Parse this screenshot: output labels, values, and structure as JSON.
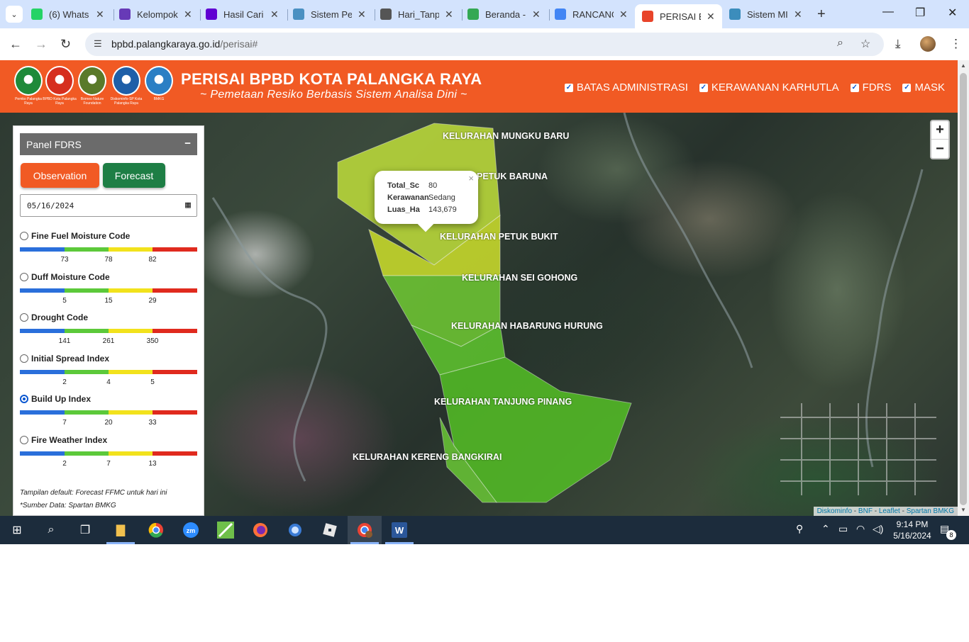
{
  "browser": {
    "tabs": [
      {
        "title": "(6) Whats",
        "icon": "whatsapp-icon",
        "color": "#25d366"
      },
      {
        "title": "Kelompok",
        "icon": "forms-icon",
        "color": "#673ab7"
      },
      {
        "title": "Hasil Cari",
        "icon": "yahoo-icon",
        "color": "#6001d2"
      },
      {
        "title": "Sistem Pe",
        "icon": "site-icon",
        "color": "#4a90c2"
      },
      {
        "title": "Hari_Tanp",
        "icon": "globe-icon",
        "color": "#555555"
      },
      {
        "title": "Beranda -",
        "icon": "drive-icon",
        "color": "#34a853"
      },
      {
        "title": "RANCANG",
        "icon": "docs-icon",
        "color": "#4285f4"
      },
      {
        "title": "PERISAI B",
        "icon": "bpbd-icon",
        "color": "#e8442a"
      },
      {
        "title": "Sistem MI",
        "icon": "map-icon",
        "color": "#3c8dbc"
      }
    ],
    "active_tab_index": 7,
    "url_host": "bpbd.palangkaraya.go.id",
    "url_path": "/perisai#"
  },
  "header": {
    "logos": [
      {
        "caption": "Pemko Palangka Raya",
        "color": "#1f8a3a"
      },
      {
        "caption": "BPBD Kota Palangka Raya",
        "color": "#d62f1f"
      },
      {
        "caption": "Borneo Nature Foundation",
        "color": "#5a7a2a"
      },
      {
        "caption": "Diskominfo-SP Kota Palangka Raya",
        "color": "#1e5fa8"
      },
      {
        "caption": "BMKG",
        "color": "#2b7fc4"
      }
    ],
    "title": "PERISAI BPBD KOTA PALANGKA RAYA",
    "subtitle": "~ Pemetaan Resiko Berbasis Sistem Analisa Dini ~",
    "layers": [
      "BATAS ADMINISTRASI",
      "KERAWANAN KARHUTLA",
      "FDRS",
      "MASK"
    ]
  },
  "panel": {
    "title": "Panel FDRS",
    "minimize": "−",
    "btn_observation": "Observation",
    "btn_forecast": "Forecast",
    "date": "05/16/2024",
    "indices": [
      {
        "name": "Fine Fuel Moisture Code",
        "ticks": [
          "73",
          "78",
          "82"
        ],
        "selected": false
      },
      {
        "name": "Duff Moisture Code",
        "ticks": [
          "5",
          "15",
          "29"
        ],
        "selected": false
      },
      {
        "name": "Drought Code",
        "ticks": [
          "141",
          "261",
          "350"
        ],
        "selected": false
      },
      {
        "name": "Initial Spread Index",
        "ticks": [
          "2",
          "4",
          "5"
        ],
        "selected": false
      },
      {
        "name": "Build Up Index",
        "ticks": [
          "7",
          "20",
          "33"
        ],
        "selected": true
      },
      {
        "name": "Fire Weather Index",
        "ticks": [
          "2",
          "7",
          "13"
        ],
        "selected": false
      }
    ],
    "scale_colors": [
      "#2a6fdb",
      "#5cc93a",
      "#f2e21c",
      "#e02a1e"
    ],
    "note_default": "Tampilan default: Forecast FFMC untuk hari ini",
    "note_source": "*Sumber Data: Spartan BMKG"
  },
  "map": {
    "kelurahan": [
      "KELURAHAN MUNGKU BARU",
      "PETUK BARUNA",
      "KELURAHAN PETUK BUKIT",
      "KELURAHAN SEI GOHONG",
      "KELURAHAN HABARUNG HURUNG",
      "KELURAHAN TANJUNG PINANG",
      "KELURAHAN KERENG BANGKIRAI"
    ],
    "popup": {
      "rows": [
        {
          "key": "Total_Sc",
          "value": "80"
        },
        {
          "key": "Kerawanan",
          "value": "Sedang"
        },
        {
          "key": "Luas_Ha",
          "value": "143,679"
        }
      ]
    },
    "attribution": [
      "Diskominfo",
      "BNF",
      "Leaflet",
      "Spartan BMKG"
    ]
  },
  "taskbar": {
    "time": "9:14 PM",
    "date": "5/16/2024",
    "notifications": "8"
  }
}
